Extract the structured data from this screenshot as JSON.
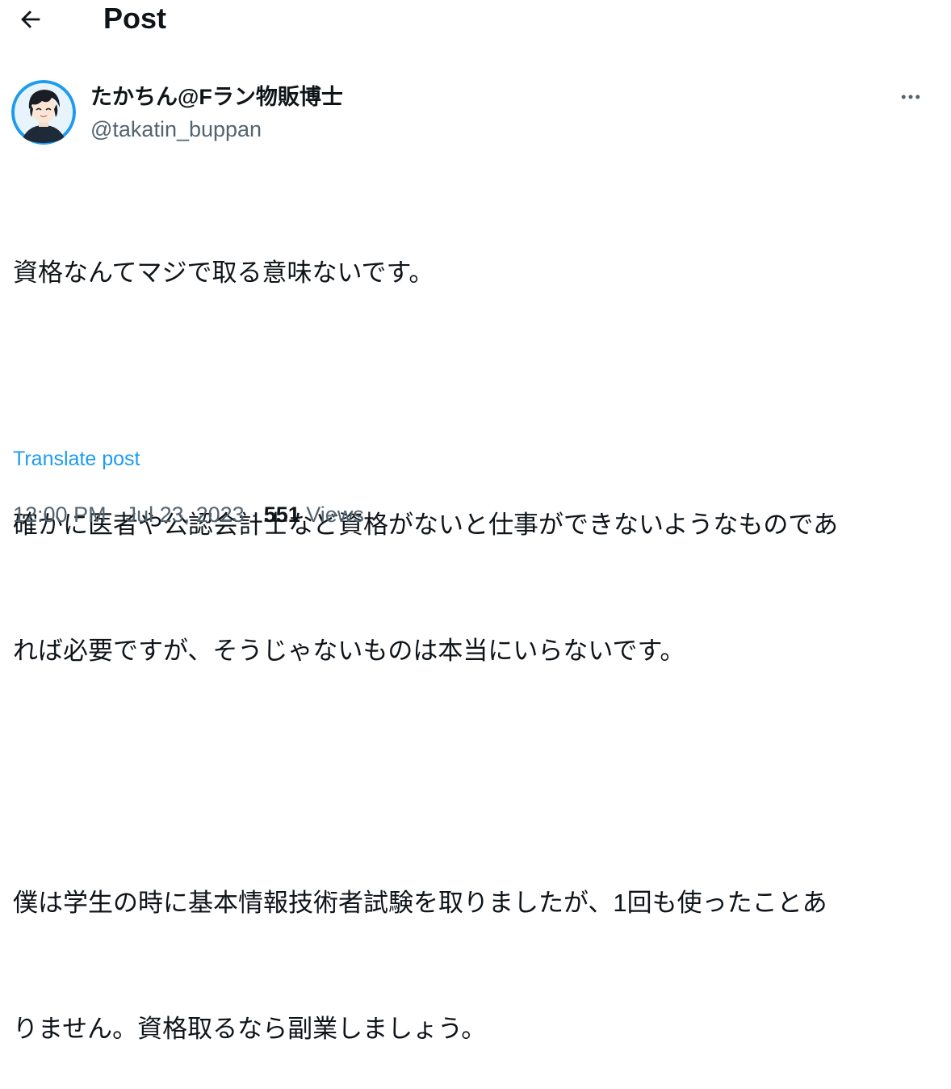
{
  "header": {
    "back_icon": "arrow-left-icon",
    "title": "Post"
  },
  "author": {
    "avatar_icon": "anime-avatar-icon",
    "display_name": "たかちん@Fラン物販博士",
    "handle": "@takatin_buppan"
  },
  "more_icon": "more-horizontal-icon",
  "post": {
    "lines": [
      "資格なんてマジで取る意味ないです。",
      "確かに医者や公認会計士など資格がないと仕事ができないようなものであ",
      "れば必要ですが、そうじゃないものは本当にいらないです。",
      "僕は学生の時に基本情報技術者試験を取りましたが、1回も使ったことあ",
      "りません。資格取るなら副業しましょう。"
    ],
    "translate_label": "Translate post"
  },
  "meta": {
    "time": "12:00 PM",
    "separator": " · ",
    "date": "Jul 23, 2023",
    "views_count": "551",
    "views_label": "Views"
  },
  "colors": {
    "text_primary": "#0f1419",
    "text_secondary": "#536471",
    "link": "#1d9bf0",
    "avatar_ring": "#1d9bf0"
  }
}
